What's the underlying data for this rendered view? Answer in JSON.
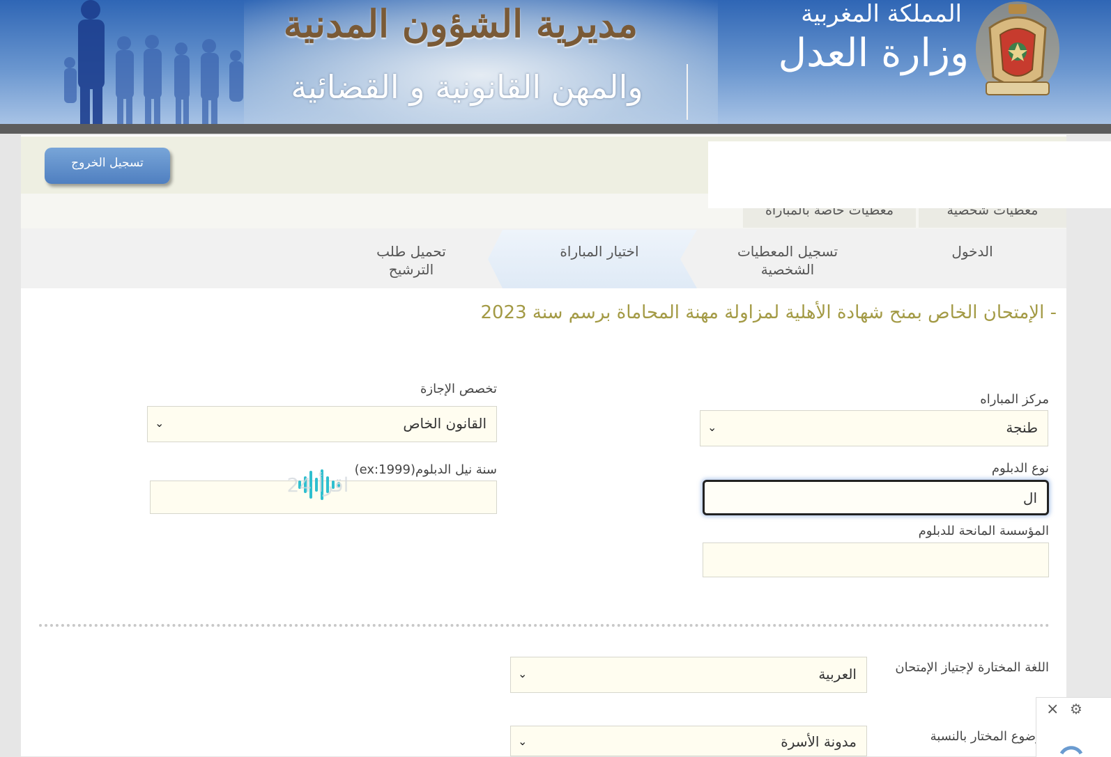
{
  "header": {
    "directorate_title": "مديرية الشؤون المدنية",
    "directorate_subtitle": "والمهن القانونية و القضائية",
    "kingdom": "المملكة المغربية",
    "ministry": "وزارة العدل"
  },
  "toolbar": {
    "logout_label": "تسجيل الخروج"
  },
  "subtabs": [
    "معطيات شخصية",
    "معطيات خاصة بالمباراة"
  ],
  "steps": [
    {
      "label": "الدخول"
    },
    {
      "label": "تسجيل المعطيات الشخصية"
    },
    {
      "label": "اختيار المباراة"
    },
    {
      "label": "تحميل طلب الترشيح"
    }
  ],
  "exam_title": "- الإمتحان الخاص بمنح شهادة الأهلية لمزاولة مهنة المحاماة برسم سنة 2023",
  "form": {
    "center_label": "مركز المباراه",
    "center_value": "طنجة",
    "specialty_label": "تخصص الإجازة",
    "specialty_value": "القانون الخاص",
    "diploma_type_label": "نوع الدبلوم",
    "diploma_type_value": "ال",
    "diploma_year_label": "سنة نيل الدبلوم(ex:1999)",
    "diploma_year_value": "",
    "institution_label": "المؤسسة المانحة للدبلوم",
    "institution_value": "",
    "language_label": "اللغة المختارة لإجتياز الإمتحان",
    "language_value": "العربية",
    "topic_label": "موضوع المختار بالنسبة",
    "topic_value": "مدونة الأسرة"
  },
  "watermark": "اقرأ 24",
  "colors": {
    "title_olive": "#a39a45",
    "logout_blue": "#5a88c6",
    "banner_blue": "#2f66b5"
  }
}
